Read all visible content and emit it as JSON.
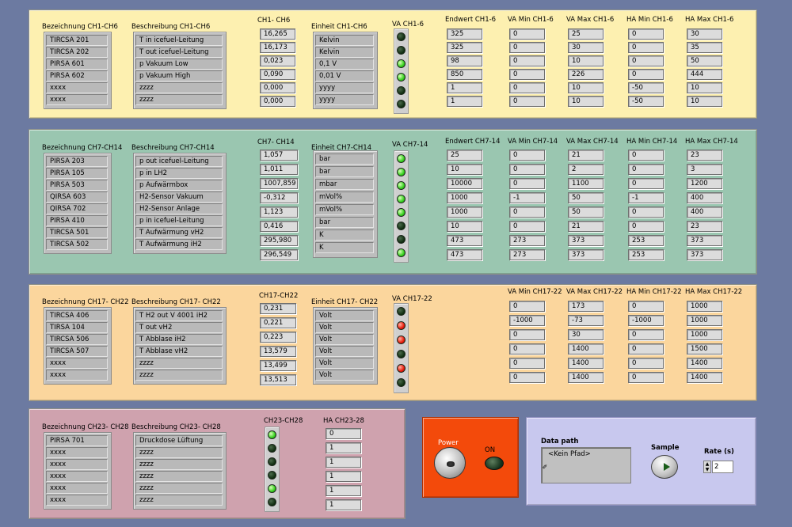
{
  "ch1_6": {
    "label_bez": "Bezeichnung CH1-CH6",
    "label_beschr": "Beschreibung CH1-CH6",
    "label_val": "CH1- CH6",
    "label_unit": "Einheit CH1-CH6",
    "label_va": "VA CH1-6",
    "label_endwert": "Endwert CH1-6",
    "label_vamin": "VA Min CH1-6",
    "label_vamax": "VA Max CH1-6",
    "label_hamin": "HA Min CH1-6",
    "label_hamax": "HA Max CH1-6",
    "names": [
      "TIRCSA 201",
      "TIRCSA 202",
      "PIRSA 601",
      "PIRSA 602",
      "xxxx",
      "xxxx"
    ],
    "descr": [
      "T in icefuel-Leitung",
      "T out icefuel-Leitung",
      "p Vakuum Low",
      "p Vakuum High",
      "zzzz",
      "zzzz"
    ],
    "values": [
      "16,265",
      "16,173",
      "0,023",
      "0,090",
      "0,000",
      "0,000"
    ],
    "units": [
      "Kelvin",
      "Kelvin",
      "0,1 V",
      "0,01 V",
      "yyyy",
      "yyyy"
    ],
    "va": [
      "off",
      "off",
      "on",
      "on",
      "off",
      "off"
    ],
    "endwert": [
      "325",
      "325",
      "98",
      "850",
      "1",
      "1"
    ],
    "vamin": [
      "0",
      "0",
      "0",
      "0",
      "0",
      "0"
    ],
    "vamax": [
      "25",
      "30",
      "10",
      "226",
      "10",
      "10"
    ],
    "hamin": [
      "0",
      "0",
      "0",
      "0",
      "-50",
      "-50"
    ],
    "hamax": [
      "30",
      "35",
      "50",
      "444",
      "10",
      "10"
    ]
  },
  "ch7_14": {
    "label_bez": "Bezeichnung CH7-CH14",
    "label_beschr": "Beschreibung CH7-CH14",
    "label_val": "CH7- CH14",
    "label_unit": "Einheit CH7-CH14",
    "label_va": "VA CH7-14",
    "label_endwert": "Endwert CH7-14",
    "label_vamin": "VA Min CH7-14",
    "label_vamax": "VA Max CH7-14",
    "label_hamin": "HA Min CH7-14",
    "label_hamax": "HA Max CH7-14",
    "names": [
      "PIRSA 203",
      "PIRSA 105",
      "PIRSA 503",
      "QIRSA 603",
      "QIRSA 702",
      "PIRSA 410",
      "TIRCSA 501",
      "TIRCSA 502"
    ],
    "descr": [
      "p out icefuel-Leitung",
      "p in LH2",
      "p Aufwärmbox",
      "H2-Sensor Vakuum",
      "H2-Sensor Anlage",
      "p in icefuel-Leitung",
      "T Aufwärmung vH2",
      "T Aufwärmung iH2"
    ],
    "values": [
      "1,057",
      "1,011",
      "1007,859",
      "-0,312",
      "1,123",
      "0,416",
      "295,980",
      "296,549"
    ],
    "units": [
      "bar",
      "bar",
      "mbar",
      "mVol%",
      "mVol%",
      "bar",
      "K",
      "K"
    ],
    "va": [
      "on",
      "on",
      "on",
      "on",
      "on",
      "off",
      "off",
      "on"
    ],
    "endwert": [
      "25",
      "10",
      "10000",
      "1000",
      "1000",
      "10",
      "473",
      "473"
    ],
    "vamin": [
      "0",
      "0",
      "0",
      "-1",
      "0",
      "0",
      "273",
      "273"
    ],
    "vamax": [
      "21",
      "2",
      "1100",
      "50",
      "50",
      "21",
      "373",
      "373"
    ],
    "hamin": [
      "0",
      "0",
      "0",
      "-1",
      "0",
      "0",
      "253",
      "253"
    ],
    "hamax": [
      "23",
      "3",
      "1200",
      "400",
      "400",
      "23",
      "373",
      "373"
    ]
  },
  "ch17_22": {
    "label_bez": "Bezeichnung CH17- CH22",
    "label_beschr": "Beschreibung CH17- CH22",
    "label_val": "CH17-CH22",
    "label_unit": "Einheit CH17- CH22",
    "label_va": "VA CH17-22",
    "label_vamin": "VA Min CH17-22",
    "label_vamax": "VA Max CH17-22",
    "label_hamin": "HA Min CH17-22",
    "label_hamax": "HA Max CH17-22",
    "names": [
      "TIRCSA 406",
      "TIRSA 104",
      "TIRCSA 506",
      "TIRCSA 507",
      "xxxx",
      "xxxx"
    ],
    "descr": [
      "T H2 out V 4001 iH2",
      "T out vH2",
      "T Abblase iH2",
      "T Abblase vH2",
      "zzzz",
      "zzzz"
    ],
    "values": [
      "0,231",
      "0,221",
      "0,223",
      "13,579",
      "13,499",
      "13,513"
    ],
    "units": [
      "Volt",
      "Volt",
      "Volt",
      "Volt",
      "Volt",
      "Volt"
    ],
    "va": [
      "off",
      "red",
      "red",
      "off",
      "red",
      "off"
    ],
    "vamin": [
      "0",
      "-1000",
      "0",
      "0",
      "0",
      "0"
    ],
    "vamax": [
      "173",
      "-73",
      "30",
      "1400",
      "1400",
      "1400"
    ],
    "hamin": [
      "0",
      "-1000",
      "0",
      "0",
      "0",
      "0"
    ],
    "hamax": [
      "1000",
      "1000",
      "1000",
      "1500",
      "1400",
      "1400"
    ]
  },
  "ch23_28": {
    "label_bez": "Bezeichnung CH23- CH28",
    "label_beschr": "Beschreibung CH23- CH28",
    "label_leds": "CH23-CH28",
    "label_ha": "HA CH23-28",
    "names": [
      "PIRSA 701",
      "xxxx",
      "xxxx",
      "xxxx",
      "xxxx",
      "xxxx"
    ],
    "descr": [
      "Druckdose Lüftung",
      "zzzz",
      "zzzz",
      "zzzz",
      "zzzz",
      "zzzz"
    ],
    "leds": [
      "on",
      "off",
      "off",
      "off",
      "on",
      "off"
    ],
    "ha": [
      "0",
      "1",
      "1",
      "1",
      "1",
      "1"
    ]
  },
  "power": {
    "label": "Power",
    "on_label": "ON"
  },
  "controls": {
    "data_path_label": "Data path",
    "data_path_value": "<Kein Pfad>",
    "sample_label": "Sample",
    "rate_label": "Rate (s)",
    "rate_value": "2"
  },
  "colors": {
    "background": "#6c7aa1",
    "panel1": "#fdf0b0",
    "panel2": "#9ac6b0",
    "panel3": "#fbd69d",
    "panel4": "#cfa2ae",
    "power_panel": "#f34a0b",
    "control_panel": "#c8c8ee"
  }
}
